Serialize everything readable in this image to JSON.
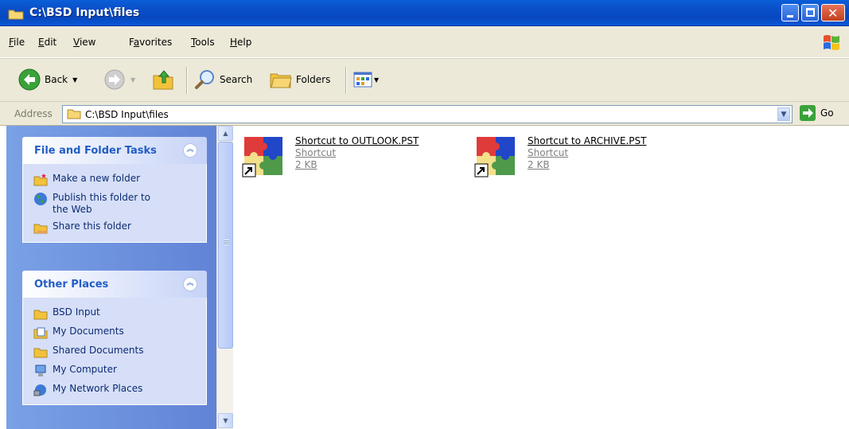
{
  "window": {
    "title": "C:\\BSD Input\\files",
    "icon": "folder-icon"
  },
  "menu": {
    "items": [
      {
        "pre": "",
        "u": "F",
        "post": "ile"
      },
      {
        "pre": "",
        "u": "E",
        "post": "dit"
      },
      {
        "pre": "",
        "u": "V",
        "post": "iew"
      },
      {
        "pre": "F",
        "u": "a",
        "post": "vorites"
      },
      {
        "pre": "",
        "u": "T",
        "post": "ools"
      },
      {
        "pre": "",
        "u": "H",
        "post": "elp"
      }
    ]
  },
  "toolbar": {
    "back_label": "Back",
    "search_label": "Search",
    "folders_label": "Folders"
  },
  "address": {
    "label": "Address",
    "value": "C:\\BSD Input\\files",
    "go_label": "Go"
  },
  "tasks_panel": {
    "title": "File and Folder Tasks",
    "items": [
      {
        "label": "Make a new folder",
        "icon": "new-folder-icon"
      },
      {
        "label": "Publish this folder to the Web",
        "icon": "globe-icon"
      },
      {
        "label": "Share this folder",
        "icon": "share-folder-icon"
      }
    ]
  },
  "places_panel": {
    "title": "Other Places",
    "items": [
      {
        "label": "BSD Input",
        "icon": "folder-icon"
      },
      {
        "label": "My Documents",
        "icon": "my-documents-icon"
      },
      {
        "label": "Shared Documents",
        "icon": "folder-icon"
      },
      {
        "label": "My Computer",
        "icon": "computer-icon"
      },
      {
        "label": "My Network Places",
        "icon": "network-icon"
      }
    ]
  },
  "files": [
    {
      "name": "Shortcut to OUTLOOK.PST",
      "type": "Shortcut",
      "size": "2 KB",
      "icon": "puzzle-shortcut-icon"
    },
    {
      "name": "Shortcut to ARCHIVE.PST",
      "type": "Shortcut",
      "size": "2 KB",
      "icon": "puzzle-shortcut-icon"
    }
  ],
  "colors": {
    "titlebar": "#0a4fc8",
    "taskpane": "#6f93de",
    "panel_title": "#215dc6",
    "chrome": "#ece9d8"
  }
}
